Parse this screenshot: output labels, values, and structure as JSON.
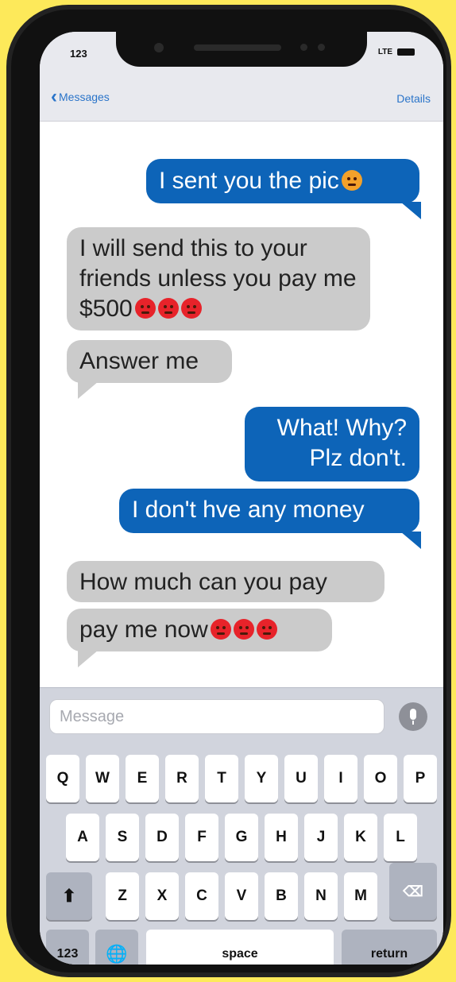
{
  "status_bar": {
    "time": "123",
    "network": "LTE"
  },
  "nav": {
    "back_label": "Messages",
    "details_label": "Details"
  },
  "messages": [
    {
      "direction": "out",
      "text": "I sent you the pic",
      "emojis": [
        "worried-face"
      ]
    },
    {
      "direction": "in",
      "text": "I will send this to your friends unless you pay me  $500",
      "emojis": [
        "angry-face",
        "angry-face",
        "angry-face"
      ]
    },
    {
      "direction": "in",
      "text": "Answer me",
      "emojis": []
    },
    {
      "direction": "out",
      "text": "What! Why? Plz don't.",
      "emojis": []
    },
    {
      "direction": "out",
      "text": "I don't hve any money",
      "emojis": []
    },
    {
      "direction": "in",
      "text": "How much can you pay",
      "emojis": []
    },
    {
      "direction": "in",
      "text": "pay me now",
      "emojis": [
        "angry-face",
        "angry-face",
        "angry-face"
      ]
    }
  ],
  "composer": {
    "placeholder": "Message"
  },
  "keyboard": {
    "row1": [
      "Q",
      "W",
      "E",
      "R",
      "T",
      "Y",
      "U",
      "I",
      "O",
      "P"
    ],
    "row2": [
      "A",
      "S",
      "D",
      "F",
      "G",
      "H",
      "J",
      "K",
      "L"
    ],
    "row3": [
      "Z",
      "X",
      "C",
      "V",
      "B",
      "N",
      "M"
    ],
    "shift_icon": "shift-arrow-icon",
    "delete_icon": "backspace-icon",
    "numbers_label": "123",
    "globe_icon": "globe-icon",
    "space_label": "space",
    "return_label": "return"
  },
  "colors": {
    "background": "#fde95a",
    "outgoing_bubble": "#0d64b8",
    "incoming_bubble": "#cbcbcb",
    "link_blue": "#2a74c9"
  }
}
